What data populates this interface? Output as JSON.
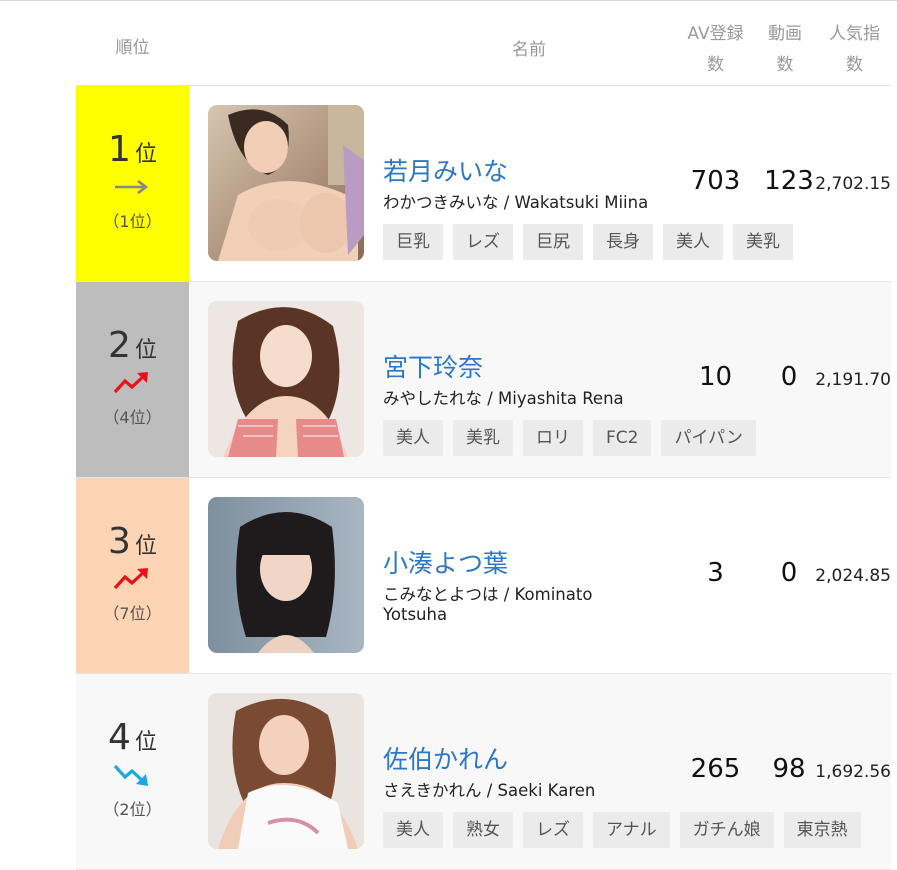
{
  "header": {
    "rank": "順位",
    "name": "名前",
    "av_line1": "AV登録",
    "av_line2": "数",
    "videos_line1": "動画",
    "videos_line2": "数",
    "popularity_line1": "人気指",
    "popularity_line2": "数"
  },
  "rank_suffix": "位",
  "rows": [
    {
      "rank": "1",
      "prev": "（1位）",
      "trend": "flat",
      "rank_color": "#ffff00",
      "name": "若月みいな",
      "kana": "わかつきみいな / Wakatsuki Miina",
      "tags": [
        "巨乳",
        "レズ",
        "巨尻",
        "長身",
        "美人",
        "美乳"
      ],
      "av_count": "703",
      "videos": "123",
      "popularity": "2,702.15"
    },
    {
      "rank": "2",
      "prev": "（4位）",
      "trend": "up",
      "rank_color": "#bdbdbd",
      "name": "宮下玲奈",
      "kana": "みやしたれな / Miyashita Rena",
      "tags": [
        "美人",
        "美乳",
        "ロリ",
        "FC2",
        "パイパン"
      ],
      "av_count": "10",
      "videos": "0",
      "popularity": "2,191.70"
    },
    {
      "rank": "3",
      "prev": "（7位）",
      "trend": "up",
      "rank_color": "#fdd5b4",
      "name": "小湊よつ葉",
      "kana": "こみなとよつは / Kominato Yotsuha",
      "tags": [],
      "av_count": "3",
      "videos": "0",
      "popularity": "2,024.85"
    },
    {
      "rank": "4",
      "prev": "（2位）",
      "trend": "down",
      "rank_color": "#f8f8f8",
      "name": "佐伯かれん",
      "kana": "さえきかれん / Saeki Karen",
      "tags": [
        "美人",
        "熟女",
        "レズ",
        "アナル",
        "ガチん娘",
        "東京熱"
      ],
      "av_count": "265",
      "videos": "98",
      "popularity": "1,692.56"
    }
  ],
  "colors": {
    "link": "#2b78c8",
    "trend_up": "#e8101a",
    "trend_down": "#19a7e6",
    "trend_flat": "#888888"
  },
  "icons": {
    "flat": "arrow-right-icon",
    "up": "trend-up-icon",
    "down": "trend-down-icon"
  }
}
